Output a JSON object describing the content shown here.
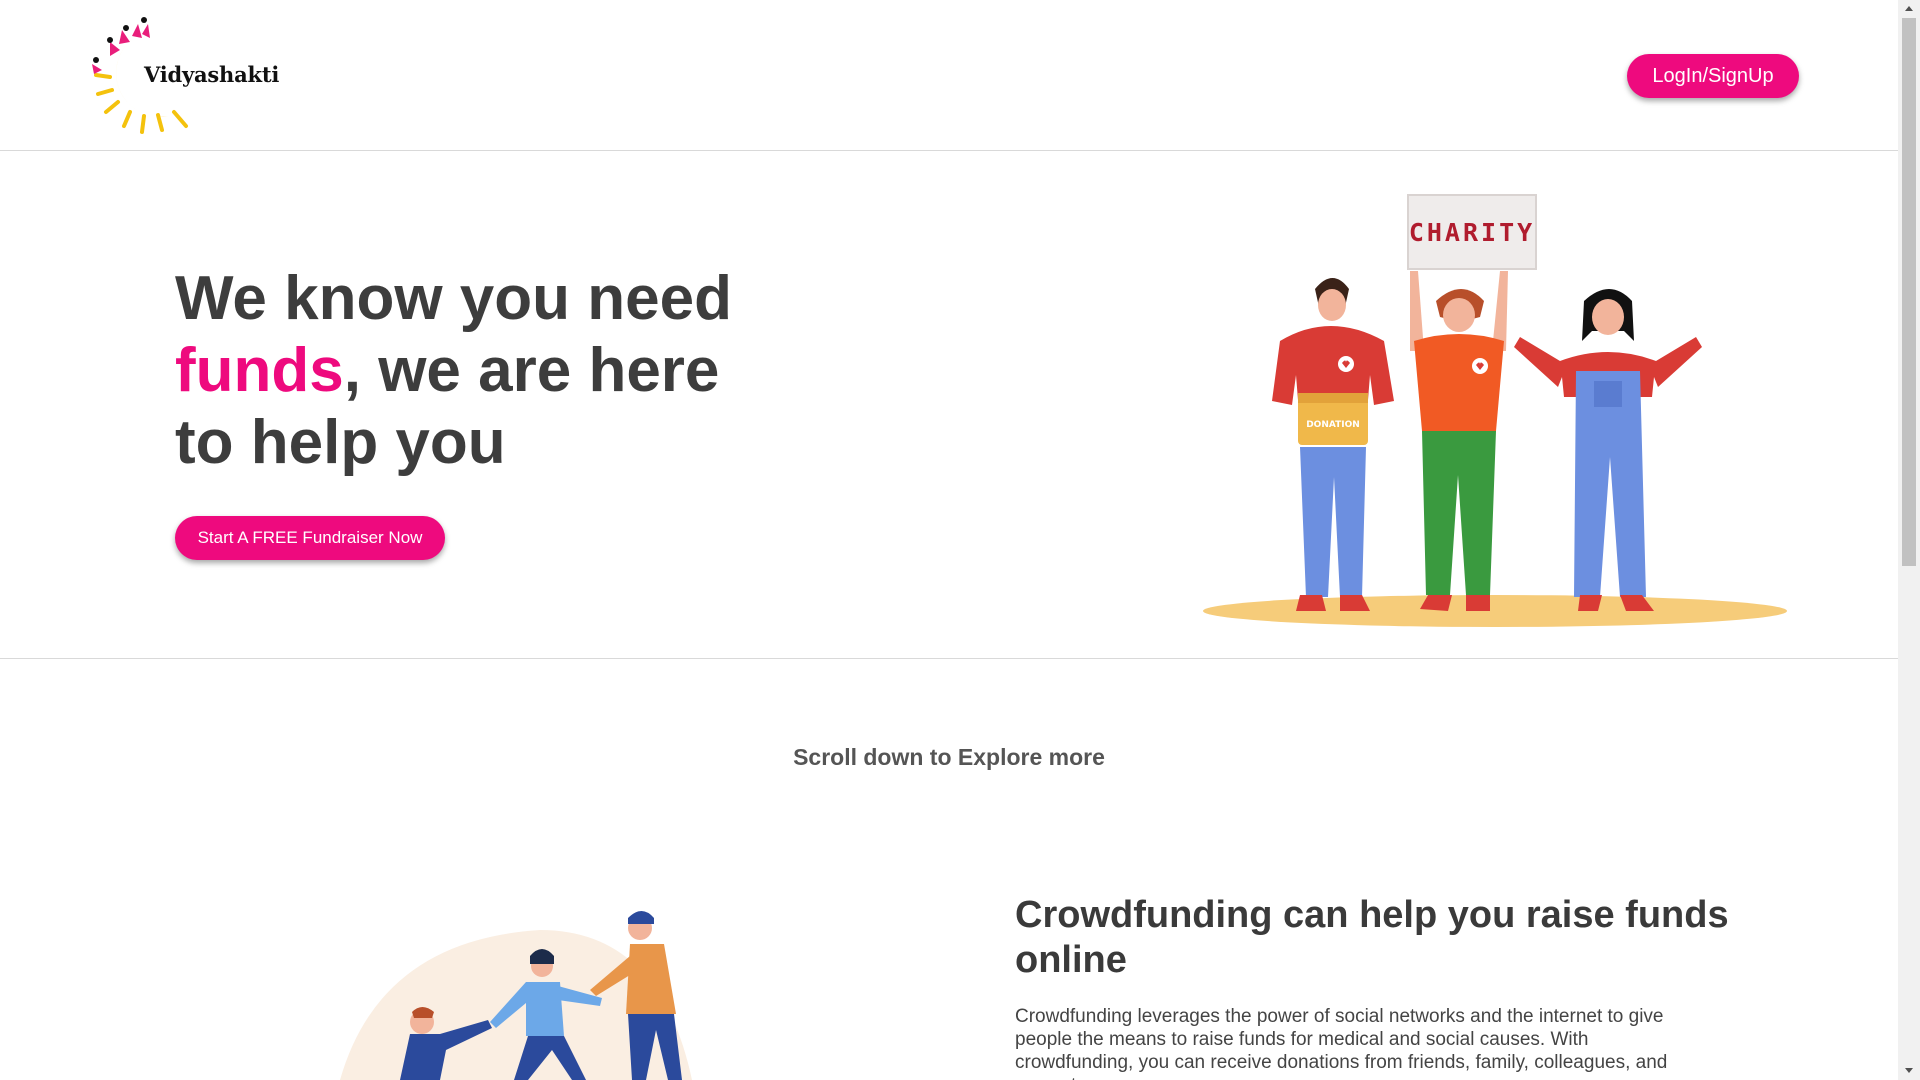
{
  "header": {
    "logo_text": "Vidyashakti",
    "login_label": "LogIn/SignUp"
  },
  "hero": {
    "title_part1": "We know you need",
    "title_accent": "funds",
    "title_part2": ", we are here to help you",
    "cta_label": "Start A FREE Fundraiser Now",
    "sign_text": "CHARITY",
    "box_text": "DONATION"
  },
  "explore": {
    "text": "Scroll down to Explore more"
  },
  "crowdfunding": {
    "title": "Crowdfunding can help you raise funds online",
    "body": "Crowdfunding leverages the power of social networks and the internet to give people the means to raise funds for medical and social causes. With crowdfunding, you can receive donations from friends, family, colleagues, and even strangers."
  },
  "colors": {
    "accent": "#ee0a7e",
    "text": "#3d3d3d"
  }
}
